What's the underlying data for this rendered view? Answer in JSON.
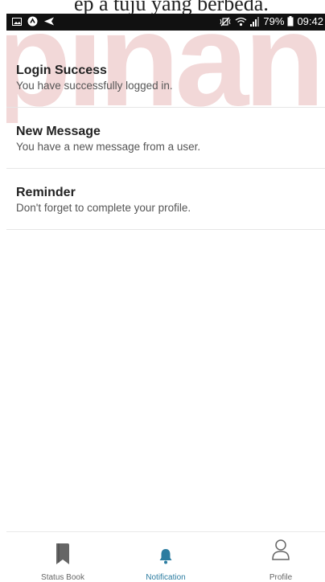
{
  "top_caption": "ep a tuju yang berbeda.",
  "watermark_text": "pinan",
  "status_bar": {
    "battery": "79%",
    "time": "09:42",
    "left_icons": [
      "image-icon",
      "app-icon",
      "send-icon"
    ],
    "right_icons": [
      "mute-vibrate-icon",
      "wifi-icon",
      "signal-icon",
      "battery-icon"
    ]
  },
  "notifications": [
    {
      "title": "Login Success",
      "message": "You have successfully logged in."
    },
    {
      "title": "New Message",
      "message": "You have a new message from a user."
    },
    {
      "title": "Reminder",
      "message": "Don't forget to complete your profile."
    }
  ],
  "bottom_nav": {
    "items": [
      {
        "label": "Status Book",
        "icon": "bookmark-icon",
        "active": false
      },
      {
        "label": "Notification",
        "icon": "bell-icon",
        "active": true
      },
      {
        "label": "Profile",
        "icon": "person-icon",
        "active": false
      }
    ]
  },
  "colors": {
    "active_tab": "#2b7ca0",
    "inactive_icon": "#666666",
    "status_bar_bg": "#111111",
    "watermark": "#f2d8d8"
  }
}
